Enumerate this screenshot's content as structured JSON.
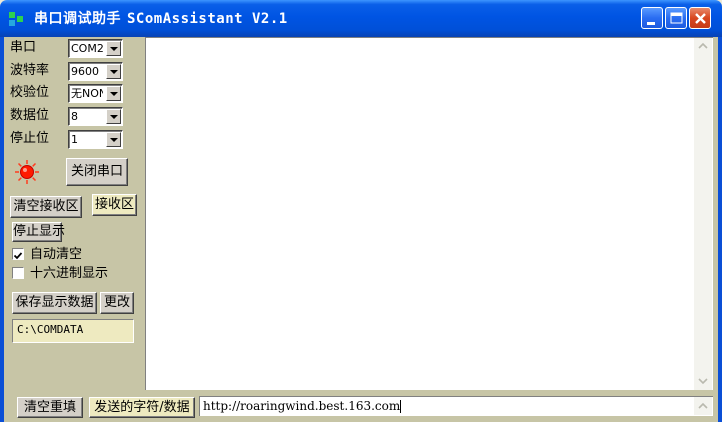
{
  "window": {
    "title_cn": "串口调试助手",
    "title_app": "SComAssistant V2.1"
  },
  "settings": [
    {
      "label": "串口",
      "value": "COM2"
    },
    {
      "label": "波特率",
      "value": "9600"
    },
    {
      "label": "校验位",
      "value": "无NONE"
    },
    {
      "label": "数据位",
      "value": "8"
    },
    {
      "label": "停止位",
      "value": "1"
    }
  ],
  "port": {
    "status_icon": "red-led-icon",
    "status_color": "#ff0000",
    "close_button": "关闭串口"
  },
  "receive": {
    "clear_button": "清空接收区",
    "area_label": "接收区",
    "stop_display_button": "停止显示",
    "auto_clear_label": "自动清空",
    "auto_clear_checked": true,
    "hex_display_label": "十六进制显示",
    "hex_display_checked": false,
    "save_button": "保存显示数据",
    "change_button": "更改",
    "save_path": "C:\\COMDATA",
    "content": ""
  },
  "send": {
    "clear_button": "清空重填",
    "label": "发送的字符/数据",
    "value": "http://roaringwind.best.163.com"
  },
  "colors": {
    "titlebar": "#0054e3",
    "panel": "#c7c5a6",
    "highlight_field": "#eeeac0"
  }
}
